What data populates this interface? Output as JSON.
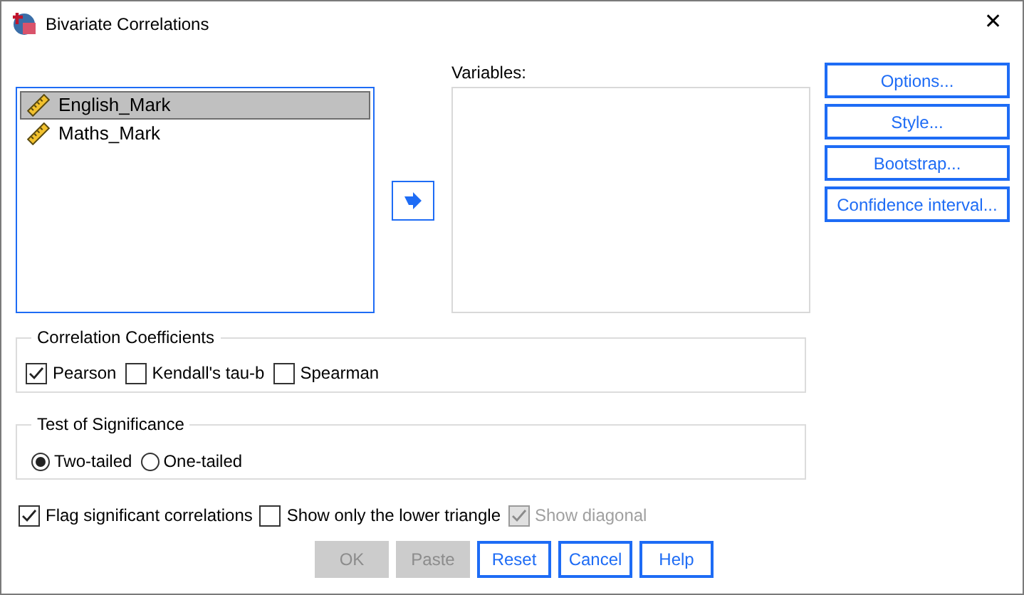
{
  "window": {
    "title": "Bivariate Correlations",
    "close": "✕"
  },
  "source_list": {
    "items": [
      {
        "label": "English_Mark",
        "selected": true
      },
      {
        "label": "Maths_Mark",
        "selected": false
      }
    ]
  },
  "variables": {
    "label": "Variables:"
  },
  "side_buttons": [
    {
      "label": "Options..."
    },
    {
      "label": "Style..."
    },
    {
      "label": "Bootstrap..."
    },
    {
      "label": "Confidence interval..."
    }
  ],
  "coefficients": {
    "title": "Correlation Coefficients",
    "options": [
      {
        "label": "Pearson",
        "checked": true
      },
      {
        "label": "Kendall's tau-b",
        "checked": false
      },
      {
        "label": "Spearman",
        "checked": false
      }
    ]
  },
  "significance": {
    "title": "Test of Significance",
    "options": [
      {
        "label": "Two-tailed",
        "selected": true
      },
      {
        "label": "One-tailed",
        "selected": false
      }
    ]
  },
  "flags": [
    {
      "label": "Flag significant correlations",
      "checked": true,
      "disabled": false
    },
    {
      "label": "Show only the lower triangle",
      "checked": false,
      "disabled": false
    },
    {
      "label": "Show diagonal",
      "checked": true,
      "disabled": true
    }
  ],
  "buttons": [
    {
      "label": "OK",
      "disabled": true
    },
    {
      "label": "Paste",
      "disabled": true
    },
    {
      "label": "Reset",
      "disabled": false
    },
    {
      "label": "Cancel",
      "disabled": false
    },
    {
      "label": "Help",
      "disabled": false
    }
  ]
}
